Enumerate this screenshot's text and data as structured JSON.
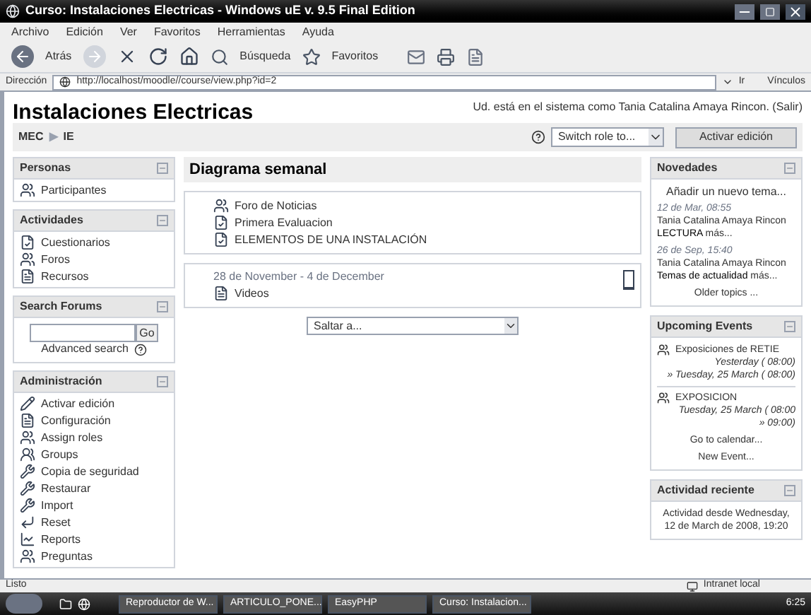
{
  "window": {
    "title": "Curso: Instalaciones Electricas - Windows uE v. 9.5 Final Edition"
  },
  "menu": [
    "Archivo",
    "Edición",
    "Ver",
    "Favoritos",
    "Herramientas",
    "Ayuda"
  ],
  "toolbar": {
    "back": "Atrás",
    "search": "Búsqueda",
    "favorites": "Favoritos"
  },
  "address": {
    "label": "Dirección",
    "value": "http://localhost/moodle//course/view.php?id=2",
    "go": "Ir",
    "links": "Vínculos"
  },
  "page": {
    "login": "Ud. está en el sistema como Tania Catalina Amaya Rincon. (Salir)",
    "heading": "Instalaciones Electricas",
    "breadcrumb": [
      "MEC",
      "IE"
    ],
    "breadcrumb_separator": "▶",
    "switch_role": "Switch role to...",
    "edit_button": "Activar edición"
  },
  "left_blocks": [
    {
      "title": "Personas",
      "kind": "list",
      "items": [
        {
          "label": "Participantes",
          "kind": "people"
        }
      ]
    },
    {
      "title": "Actividades",
      "kind": "list",
      "items": [
        {
          "label": "Cuestionarios",
          "kind": "quiz"
        },
        {
          "label": "Foros",
          "kind": "people"
        },
        {
          "label": "Recursos",
          "kind": "doc"
        }
      ]
    },
    {
      "title": "Search Forums",
      "kind": "search",
      "button": "Go",
      "link": "Advanced search"
    },
    {
      "title": "Administración",
      "kind": "list",
      "items": [
        {
          "label": "Activar edición",
          "kind": "pen"
        },
        {
          "label": "Configuración",
          "kind": "doc"
        },
        {
          "label": "Assign roles",
          "kind": "people"
        },
        {
          "label": "Groups",
          "kind": "group"
        },
        {
          "label": "Copia de seguridad",
          "kind": "tool"
        },
        {
          "label": "Restaurar",
          "kind": "tool"
        },
        {
          "label": "Import",
          "kind": "tool"
        },
        {
          "label": "Reset",
          "kind": "arrow"
        },
        {
          "label": "Reports",
          "kind": "chart"
        },
        {
          "label": "Preguntas",
          "kind": "people"
        }
      ]
    }
  ],
  "center": {
    "title": "Diagrama semanal",
    "sections": [
      {
        "items": [
          {
            "label": "Foro de Noticias",
            "kind": "people"
          },
          {
            "label": "Primera Evaluacion",
            "kind": "quiz"
          },
          {
            "label": "ELEMENTOS DE UNA INSTALACIÓN",
            "kind": "quiz"
          }
        ]
      },
      {
        "dates": "28 de November - 4 de December",
        "items": [
          {
            "label": "Videos",
            "kind": "doc"
          }
        ]
      }
    ],
    "jump": "Saltar a..."
  },
  "news": {
    "title": "Novedades",
    "add": "Añadir un nuevo tema...",
    "posts": [
      {
        "date": "12 de Mar, 08:55",
        "author": "Tania Catalina Amaya Rincon",
        "subject": "LECTURA",
        "more": "más..."
      },
      {
        "date": "26 de Sep, 15:40",
        "author": "Tania Catalina Amaya Rincon",
        "subject": "Temas de actualidad",
        "more": "más..."
      }
    ],
    "older": "Older topics ..."
  },
  "events": {
    "title": "Upcoming Events",
    "items": [
      {
        "name": "Exposiciones de RETIE",
        "lines": [
          "Yesterday ( 08:00)",
          "» Tuesday, 25 March ( 08:00)"
        ]
      },
      {
        "name": "EXPOSICION",
        "lines": [
          "Tuesday, 25 March ( 08:00",
          "» 09:00)"
        ]
      }
    ],
    "links": [
      "Go to calendar...",
      "New Event..."
    ]
  },
  "recent": {
    "title": "Actividad reciente",
    "text": "Actividad desde Wednesday, 12 de March de 2008, 19:20"
  },
  "status_bar": {
    "text": "Listo",
    "zone": "Intranet local"
  },
  "taskbar": {
    "tasks": [
      "Reproductor de W...",
      "ARTICULO_PONE...",
      "EasyPHP",
      "Curso: Instalacion..."
    ],
    "time": "6:25"
  }
}
